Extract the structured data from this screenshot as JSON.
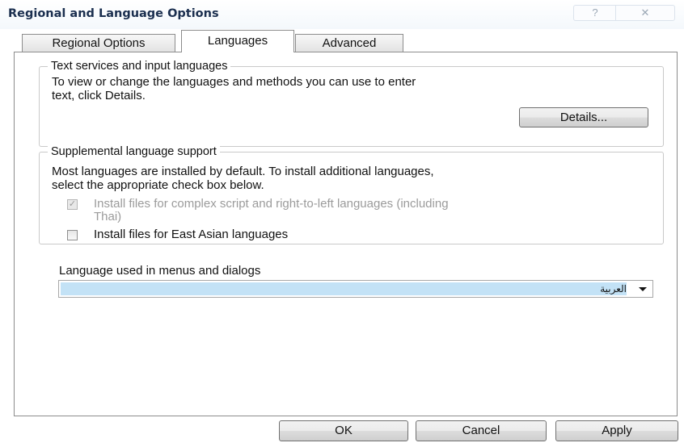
{
  "window": {
    "title": "Regional and Language Options",
    "help_glyph": "?",
    "close_glyph": "✕"
  },
  "tabs": [
    {
      "label": "Regional Options",
      "active": false
    },
    {
      "label": "Languages",
      "active": true
    },
    {
      "label": "Advanced",
      "active": false
    }
  ],
  "text_services": {
    "legend": "Text services and input languages",
    "description_line1": "To view or change the languages and methods you can use to enter",
    "description_line2": "text, click Details.",
    "details_button": "Details..."
  },
  "supplemental": {
    "legend": "Supplemental language support",
    "description_line1": "Most languages are installed by default. To install additional languages,",
    "description_line2": "select the appropriate check box below.",
    "complex_script": {
      "label_line1": "Install files for complex script and right-to-left languages (including",
      "label_line2": "Thai)",
      "checked": true,
      "enabled": false
    },
    "east_asian": {
      "label": "Install files for East Asian languages",
      "checked": false,
      "enabled": true
    }
  },
  "ui_language": {
    "label": "Language used in menus and dialogs",
    "selected": "العربية"
  },
  "footer": {
    "ok": "OK",
    "cancel": "Cancel",
    "apply": "Apply"
  },
  "colors": {
    "title_text": "#1b2f4f",
    "selection_highlight": "#c3e2f6",
    "disabled_text": "#9b9b9b"
  }
}
